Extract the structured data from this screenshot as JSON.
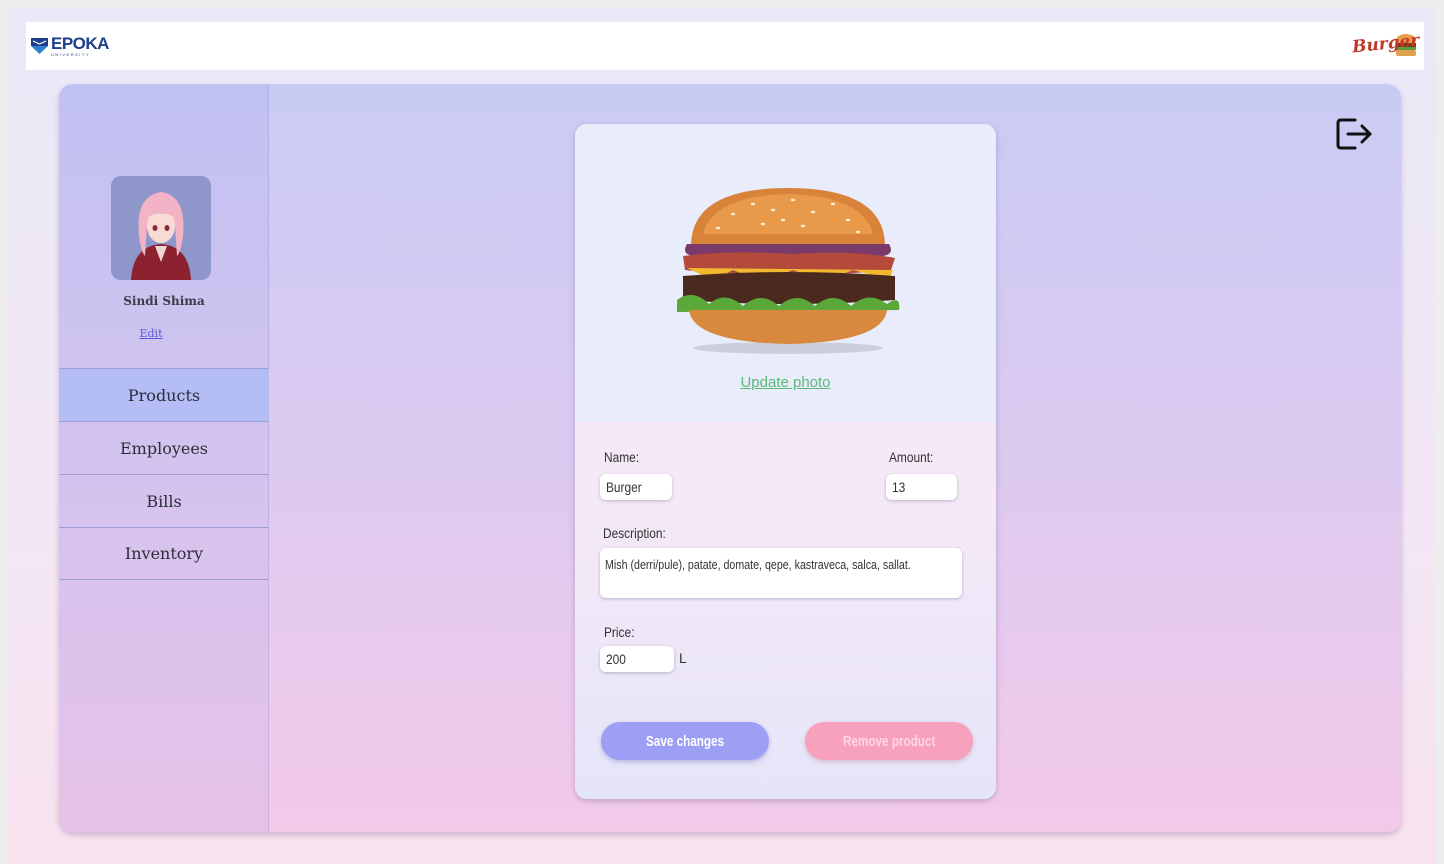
{
  "header": {
    "logo_name": "EPOKA",
    "logo_sub": "UNIVERSITY",
    "brand_name": "Burger"
  },
  "sidebar": {
    "user_name": "Sindi Shima",
    "edit_label": "Edit",
    "items": [
      {
        "label": "Products",
        "active": true
      },
      {
        "label": "Employees",
        "active": false
      },
      {
        "label": "Bills",
        "active": false
      },
      {
        "label": "Inventory",
        "active": false
      }
    ]
  },
  "product": {
    "update_photo_label": "Update photo",
    "name_label": "Name:",
    "name_value": "Burger",
    "amount_label": "Amount:",
    "amount_value": "13",
    "description_label": "Description:",
    "description_value": "Mish (derri/pule), patate, domate, qepe, kastraveca, salca, sallat.",
    "price_label": "Price:",
    "price_value": "200",
    "currency": "L",
    "save_label": "Save changes",
    "remove_label": "Remove product"
  },
  "icons": {
    "logout": "logout-icon",
    "avatar": "avatar",
    "burger": "burger-image"
  },
  "colors": {
    "save_button": "#9d9ff5",
    "remove_button": "#f7a1bd",
    "active_nav": "#b4bdf5",
    "update_photo": "#5bb87a"
  }
}
